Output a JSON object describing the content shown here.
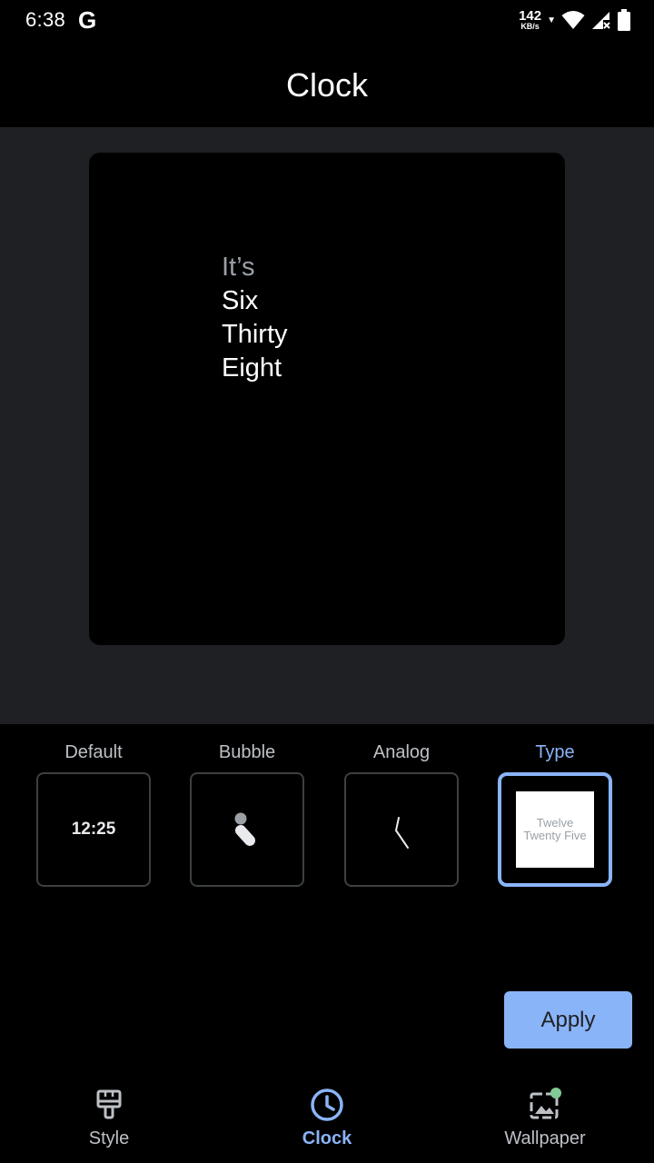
{
  "status_bar": {
    "time": "6:38",
    "g_logo": "G",
    "net_speed": "142",
    "net_unit": "KB/s"
  },
  "header": {
    "title": "Clock"
  },
  "preview": {
    "lines": [
      "It’s",
      "Six",
      "Thirty",
      "Eight"
    ]
  },
  "options": [
    {
      "label": "Default",
      "preview_text": "12:25",
      "selected": false
    },
    {
      "label": "Bubble",
      "selected": false
    },
    {
      "label": "Analog",
      "selected": false
    },
    {
      "label": "Type",
      "preview_line1": "Twelve",
      "preview_line2": "Twenty Five",
      "selected": true
    }
  ],
  "apply_label": "Apply",
  "bottom_nav": [
    {
      "label": "Style",
      "icon": "paint-brush-icon",
      "active": false
    },
    {
      "label": "Clock",
      "icon": "clock-icon",
      "active": true
    },
    {
      "label": "Wallpaper",
      "icon": "wallpaper-icon",
      "active": false
    }
  ],
  "colors": {
    "accent": "#8ab4f8",
    "preview_background": "#1f2023",
    "notification_dot": "#81c995"
  }
}
